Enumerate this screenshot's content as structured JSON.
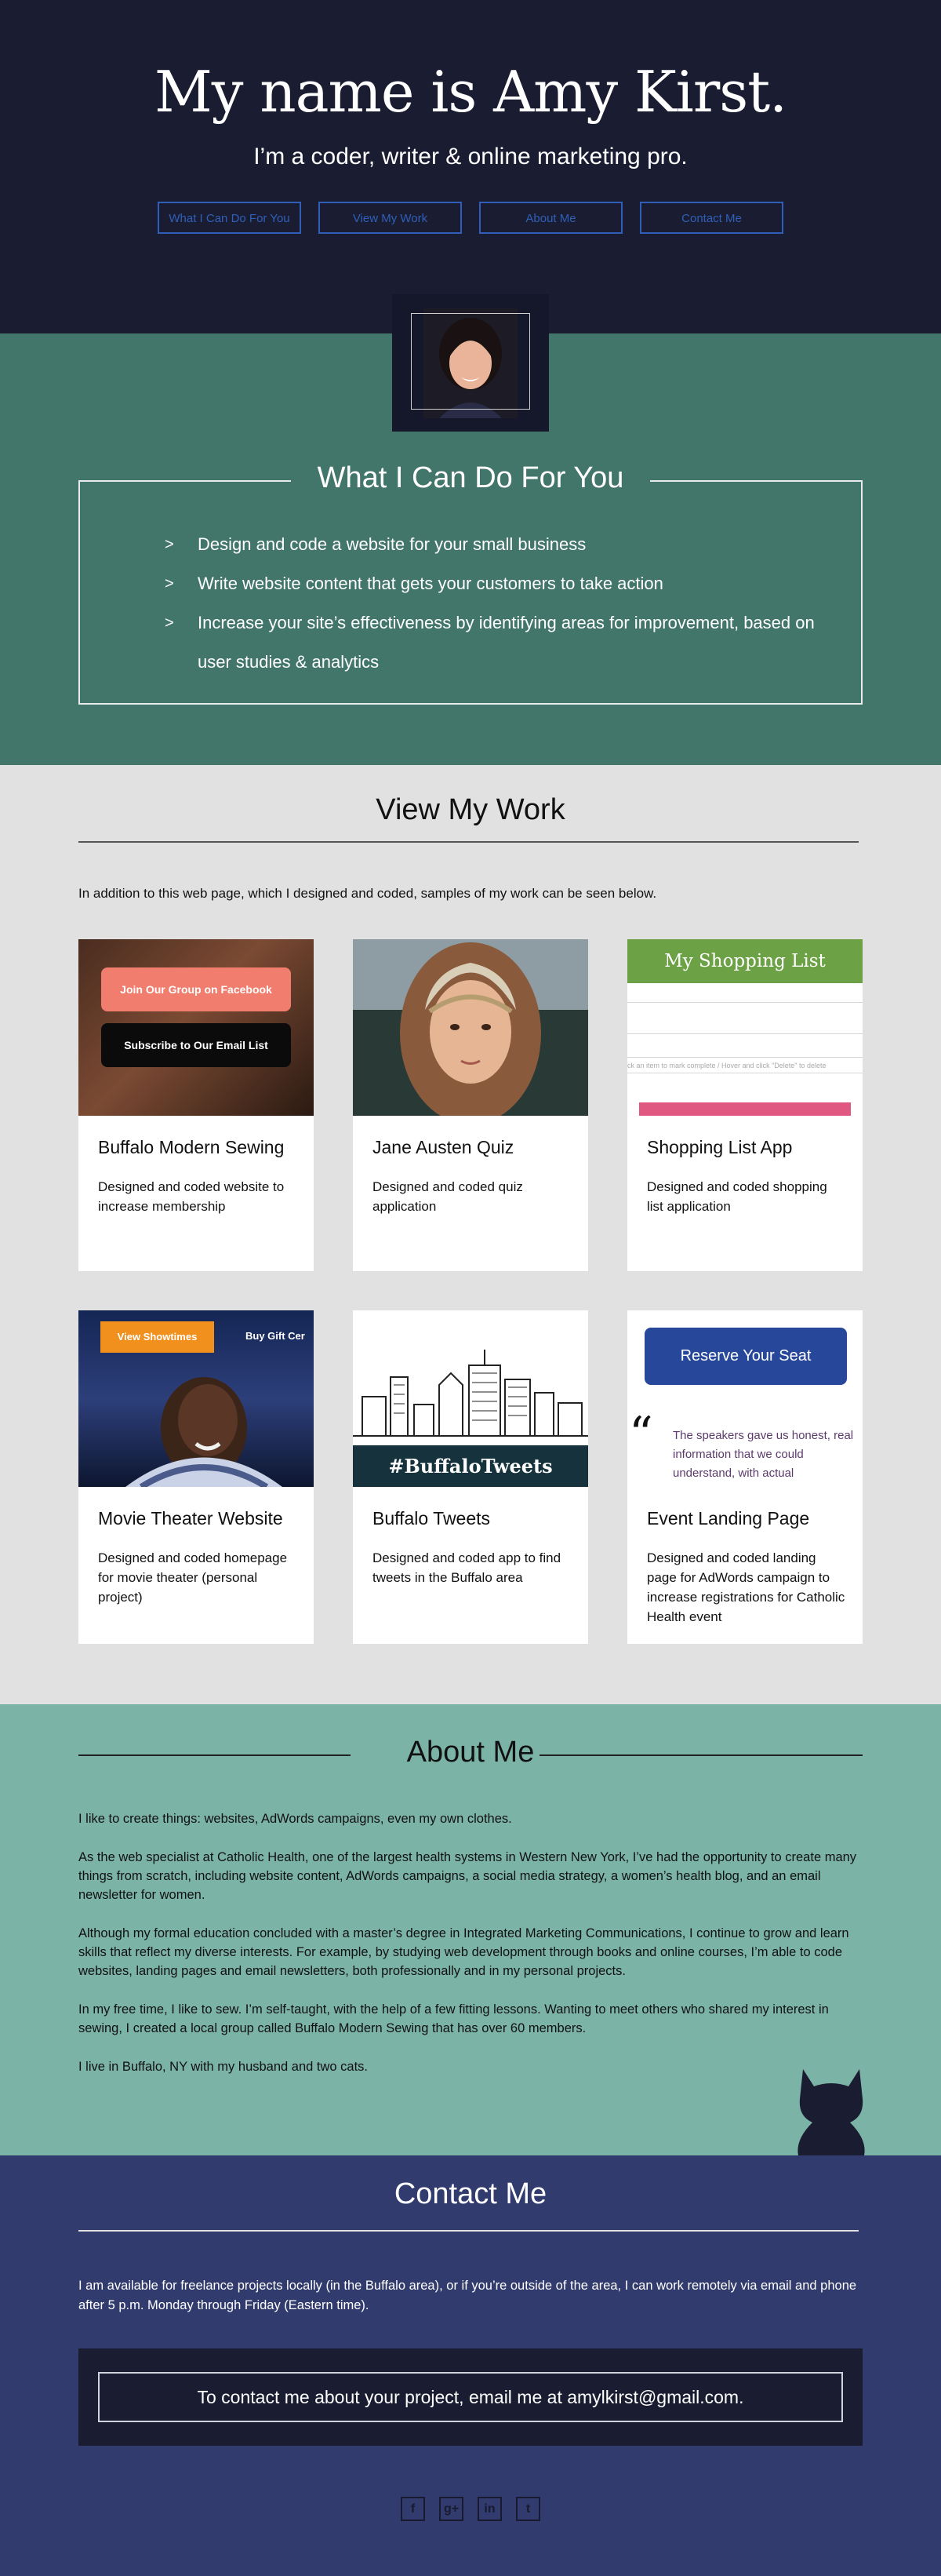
{
  "hero": {
    "title": "My name is Amy Kirst.",
    "subtitle": "I’m a coder, writer & online marketing pro.",
    "nav": [
      "What I Can Do For You",
      "View My Work",
      "About Me",
      "Contact Me"
    ]
  },
  "can_do": {
    "title": "What I Can Do For You",
    "items": [
      "Design and code a website for your small business",
      "Write website content that gets your customers to take action",
      "Increase your site’s effectiveness by identifying areas for improvement, based on user studies & analytics"
    ]
  },
  "work": {
    "title": "View My Work",
    "intro": "In addition to this web page, which I designed and coded, samples of my work can be seen below.",
    "cards": [
      {
        "title": "Buffalo Modern Sewing",
        "desc": "Designed and coded website to increase membership",
        "thumb_text": [
          "Join Our Group on Facebook",
          "Subscribe to Our Email List"
        ]
      },
      {
        "title": "Jane Austen Quiz",
        "desc": "Designed and coded quiz application"
      },
      {
        "title": "Shopping List App",
        "desc": "Designed and coded shopping list application",
        "thumb_text": [
          "My Shopping List",
          "ck an item to mark complete  /  Hover and click \"Delete\" to delete"
        ]
      },
      {
        "title": "Movie Theater Website",
        "desc": "Designed and coded homepage for movie theater (personal project)",
        "thumb_text": [
          "View Showtimes",
          "Buy Gift Cer"
        ]
      },
      {
        "title": "Buffalo Tweets",
        "desc": "Designed and coded app to find tweets in the Buffalo area",
        "thumb_text": [
          "#BuffaloTweets"
        ]
      },
      {
        "title": "Event Landing Page",
        "desc": "Designed and coded landing page for AdWords campaign to increase registrations for Catholic Health event",
        "thumb_text": [
          "Reserve Your Seat",
          "The speakers gave us honest, real information that we could understand, with actual"
        ]
      }
    ]
  },
  "about": {
    "title": "About Me",
    "paragraphs": [
      "I like to create things: websites, AdWords campaigns, even my own clothes.",
      "As the web specialist at Catholic Health, one of the largest health systems in Western New York, I’ve had the opportunity to create many things from scratch, including website content, AdWords campaigns, a social media strategy, a women’s health blog, and an email newsletter for women.",
      "Although my formal education concluded with a master’s degree in Integrated Marketing Communications, I continue to grow and learn skills that reflect my diverse interests. For example, by studying web development through books and online courses, I’m able to code websites, landing pages and email newsletters, both professionally and in my personal projects.",
      "In my free time, I like to sew. I’m self-taught, with the help of a few fitting lessons. Wanting to meet others who shared my interest in sewing, I created a local group called Buffalo Modern Sewing that has over 60 members.",
      "I live in Buffalo, NY with my husband and two cats."
    ]
  },
  "contact": {
    "title": "Contact Me",
    "text": "I am available for freelance projects locally (in the Buffalo area), or if you’re outside of the area, I can work remotely via email and phone after 5 p.m. Monday through Friday (Eastern time).",
    "cta": "To contact me about your project, email me at amylkirst@gmail.com.",
    "social": [
      {
        "icon": "facebook-icon",
        "glyph": "f"
      },
      {
        "icon": "google-plus-icon",
        "glyph": "g+"
      },
      {
        "icon": "linkedin-icon",
        "glyph": "in"
      },
      {
        "icon": "twitter-icon",
        "glyph": "t"
      }
    ]
  },
  "colors": {
    "hero_bg": "#1a1c31",
    "can_do_bg": "#43766b",
    "work_bg": "#e1e1e1",
    "about_bg": "#7bb3a6",
    "contact_bg": "#323b6d",
    "nav_link": "#2f5fb8"
  }
}
